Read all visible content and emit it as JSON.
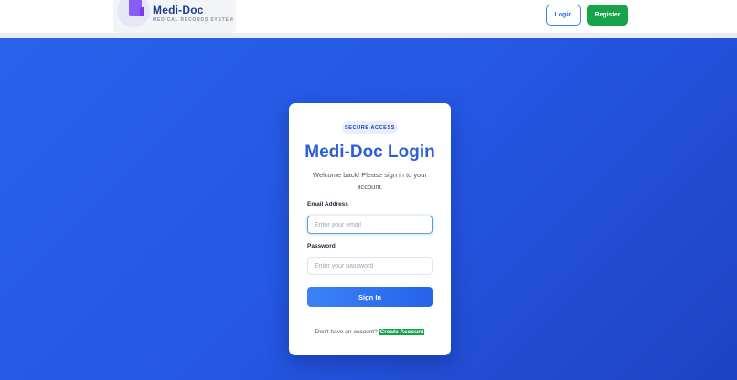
{
  "colors": {
    "brand": "#2c5fd7",
    "hero_gradient_start": "#2862ea",
    "hero_gradient_end": "#1e43c4",
    "success": "#16a34a",
    "logo_accent": "#8b5cf6"
  },
  "header": {
    "brand_title": "Medi-Doc",
    "brand_subtitle": "MEDICAL RECORDS SYSTEM",
    "logo_icon": "document-icon",
    "login_label": "Login",
    "register_label": "Register"
  },
  "login_card": {
    "badge": "SECURE ACCESS",
    "title": "Medi-Doc Login",
    "subtitle": "Welcome back! Please sign in to your account.",
    "email": {
      "label": "Email Address",
      "placeholder": "Enter your email",
      "value": ""
    },
    "password": {
      "label": "Password",
      "placeholder": "Enter your password",
      "value": ""
    },
    "submit_label": "Sign In",
    "footer_text": "Don't have an account?",
    "footer_link": "Create Account"
  }
}
